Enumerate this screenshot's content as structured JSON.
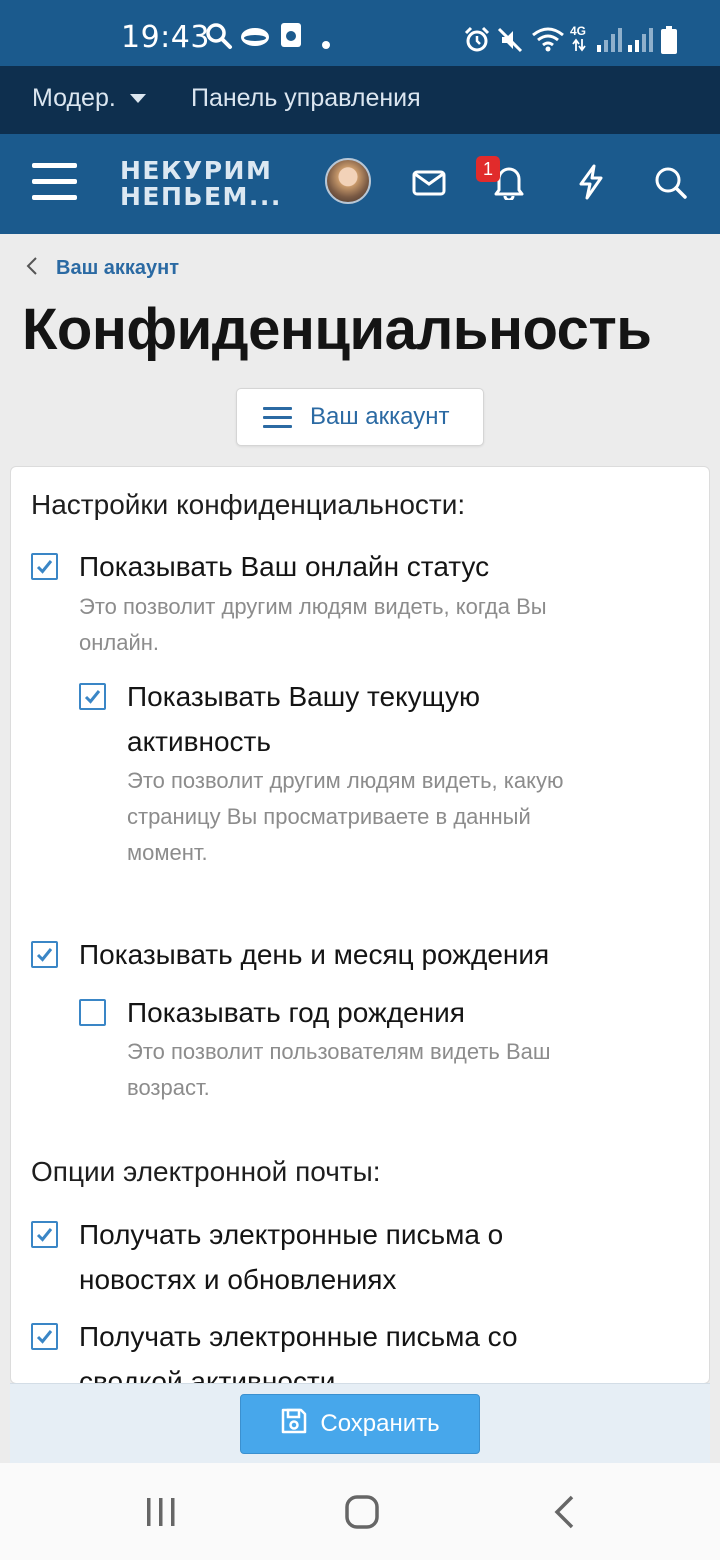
{
  "status_bar": {
    "time": "19:43",
    "network": "4G",
    "colors": {
      "background": "#1b5a8d",
      "text": "#ffffff"
    },
    "icons": [
      "search-icon",
      "cloud-icon",
      "app-icon",
      "dot-icon",
      "alarm-icon",
      "mute-icon",
      "wifi-icon",
      "signal-icon",
      "signal-icon",
      "battery-icon"
    ]
  },
  "moderator_bar": {
    "moderator_label": "Модер.",
    "panel_label": "Панель управления"
  },
  "header": {
    "logo_line1": "НЕКУРИМ",
    "logo_line2": "НЕПЬЕМ...",
    "notification_count": "1",
    "icons": [
      "menu-icon",
      "avatar",
      "mail-icon",
      "bell-icon",
      "lightning-icon",
      "search-icon"
    ]
  },
  "page": {
    "breadcrumb": "Ваш аккаунт",
    "title": "Конфиденциальность",
    "account_button_label": "Ваш аккаунт"
  },
  "privacy": {
    "heading": "Настройки конфиденциальности:",
    "online_status": {
      "label": "Показывать Ваш онлайн статус",
      "checked": true,
      "hint_line1": "Это позволит другим людям видеть, когда Вы",
      "hint_line2": "онлайн."
    },
    "current_activity": {
      "label_line1": "Показывать Вашу текущую",
      "label_line2": "активность",
      "checked": true,
      "hint_line1": "Это позволит другим людям видеть, какую",
      "hint_line2": "страницу Вы просматриваете в данный",
      "hint_line3": "момент."
    },
    "birthday": {
      "label": "Показывать день и месяц рождения",
      "checked": true
    },
    "birth_year": {
      "label": "Показывать год рождения",
      "checked": false,
      "hint_line1": "Это позволит пользователям видеть Ваш",
      "hint_line2": "возраст."
    }
  },
  "email": {
    "heading": "Опции электронной почты:",
    "news": {
      "label_line1": "Получать электронные письма о",
      "label_line2": "новостях и обновлениях",
      "checked": true
    },
    "digest": {
      "label_line1": "Получать электронные письма со",
      "label_line2": "сводкой активности",
      "checked": true
    }
  },
  "save_button": {
    "label": "Сохранить",
    "color": "#47a7eb"
  },
  "nav_bar": {
    "icons": [
      "recent-apps-icon",
      "home-icon",
      "back-icon"
    ]
  },
  "colors": {
    "primary": "#1b5a8d",
    "dark": "#0e2f4e",
    "link": "#2b6aa3",
    "checkbox": "#3a86c6",
    "hint": "#8c8c8c"
  }
}
